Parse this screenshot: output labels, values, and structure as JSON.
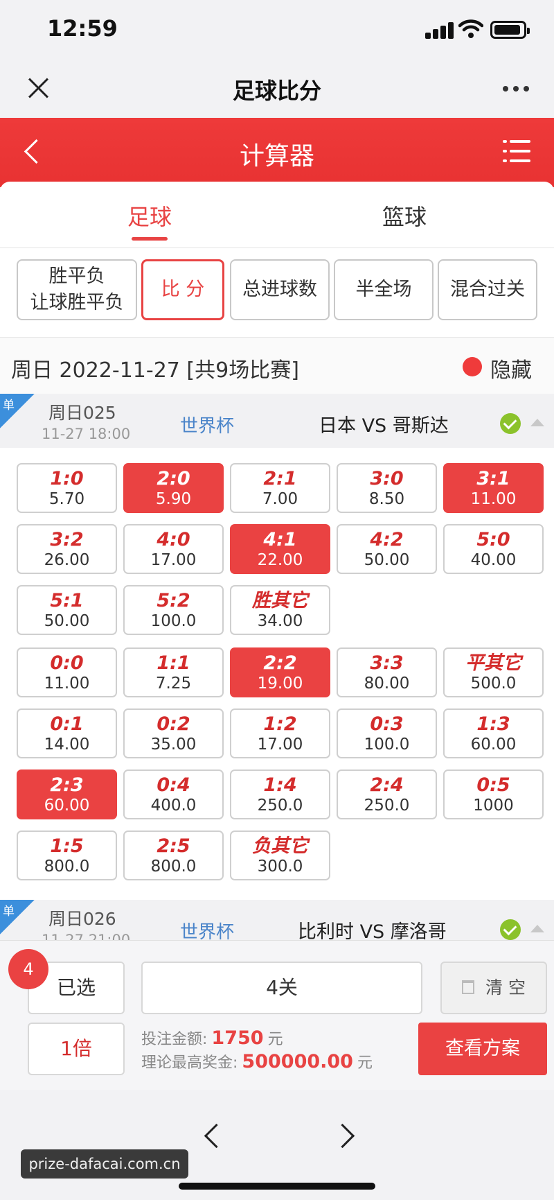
{
  "status": {
    "time": "12:59"
  },
  "browser": {
    "title": "足球比分"
  },
  "header": {
    "title": "计算器"
  },
  "sport_tabs": [
    {
      "label": "足球",
      "active": true
    },
    {
      "label": "篮球",
      "active": false
    }
  ],
  "bet_types": [
    {
      "line1": "胜平负",
      "line2": "让球胜平负",
      "selected": false
    },
    {
      "line1": "比 分",
      "line2": "",
      "selected": true
    },
    {
      "line1": "总进球数",
      "line2": "",
      "selected": false
    },
    {
      "line1": "半全场",
      "line2": "",
      "selected": false
    },
    {
      "line1": "混合过关",
      "line2": "",
      "selected": false
    }
  ],
  "date_line": {
    "text": "周日 2022-11-27 [共9场比赛]",
    "hide_label": "隐藏"
  },
  "matches": [
    {
      "corner": "单",
      "code": "周日025",
      "time": "11-27 18:00",
      "league": "世界杯",
      "teams": "日本 VS 哥斯达"
    },
    {
      "corner": "单",
      "code": "周日026",
      "time": "11-27 21:00",
      "league": "世界杯",
      "teams": "比利时 VS 摩洛哥"
    }
  ],
  "score_grid": [
    [
      {
        "score": "1:0",
        "odds": "5.70",
        "selected": false
      },
      {
        "score": "2:0",
        "odds": "5.90",
        "selected": true
      },
      {
        "score": "2:1",
        "odds": "7.00",
        "selected": false
      },
      {
        "score": "3:0",
        "odds": "8.50",
        "selected": false
      },
      {
        "score": "3:1",
        "odds": "11.00",
        "selected": true
      }
    ],
    [
      {
        "score": "3:2",
        "odds": "26.00",
        "selected": false
      },
      {
        "score": "4:0",
        "odds": "17.00",
        "selected": false
      },
      {
        "score": "4:1",
        "odds": "22.00",
        "selected": true
      },
      {
        "score": "4:2",
        "odds": "50.00",
        "selected": false
      },
      {
        "score": "5:0",
        "odds": "40.00",
        "selected": false
      }
    ],
    [
      {
        "score": "5:1",
        "odds": "50.00",
        "selected": false
      },
      {
        "score": "5:2",
        "odds": "100.0",
        "selected": false
      },
      {
        "score": "胜其它",
        "odds": "34.00",
        "selected": false
      }
    ],
    [
      {
        "score": "0:0",
        "odds": "11.00",
        "selected": false
      },
      {
        "score": "1:1",
        "odds": "7.25",
        "selected": false
      },
      {
        "score": "2:2",
        "odds": "19.00",
        "selected": true
      },
      {
        "score": "3:3",
        "odds": "80.00",
        "selected": false
      },
      {
        "score": "平其它",
        "odds": "500.0",
        "selected": false
      }
    ],
    [
      {
        "score": "0:1",
        "odds": "14.00",
        "selected": false
      },
      {
        "score": "0:2",
        "odds": "35.00",
        "selected": false
      },
      {
        "score": "1:2",
        "odds": "17.00",
        "selected": false
      },
      {
        "score": "0:3",
        "odds": "100.0",
        "selected": false
      },
      {
        "score": "1:3",
        "odds": "60.00",
        "selected": false
      }
    ],
    [
      {
        "score": "2:3",
        "odds": "60.00",
        "selected": true
      },
      {
        "score": "0:4",
        "odds": "400.0",
        "selected": false
      },
      {
        "score": "1:4",
        "odds": "250.0",
        "selected": false
      },
      {
        "score": "2:4",
        "odds": "250.0",
        "selected": false
      },
      {
        "score": "0:5",
        "odds": "1000",
        "selected": false
      }
    ],
    [
      {
        "score": "1:5",
        "odds": "800.0",
        "selected": false
      },
      {
        "score": "2:5",
        "odds": "800.0",
        "selected": false
      },
      {
        "score": "负其它",
        "odds": "300.0",
        "selected": false
      }
    ]
  ],
  "bottom": {
    "count_badge": "4",
    "selected_label": "已选",
    "pass_label": "4关",
    "clear_label": "清 空",
    "multiplier_label": "1倍",
    "amount_label": "投注金额:",
    "amount_value": "1750",
    "amount_unit": "元",
    "max_label": "理论最高奖金:",
    "max_value": "500000.00",
    "max_unit": "元",
    "view_label": "查看方案"
  },
  "watermark": "prize-dafacai.com.cn",
  "colors": {
    "accent": "#ea4242",
    "league": "#4a84c9",
    "check": "#8bc22b",
    "corner": "#3c8fdc"
  }
}
